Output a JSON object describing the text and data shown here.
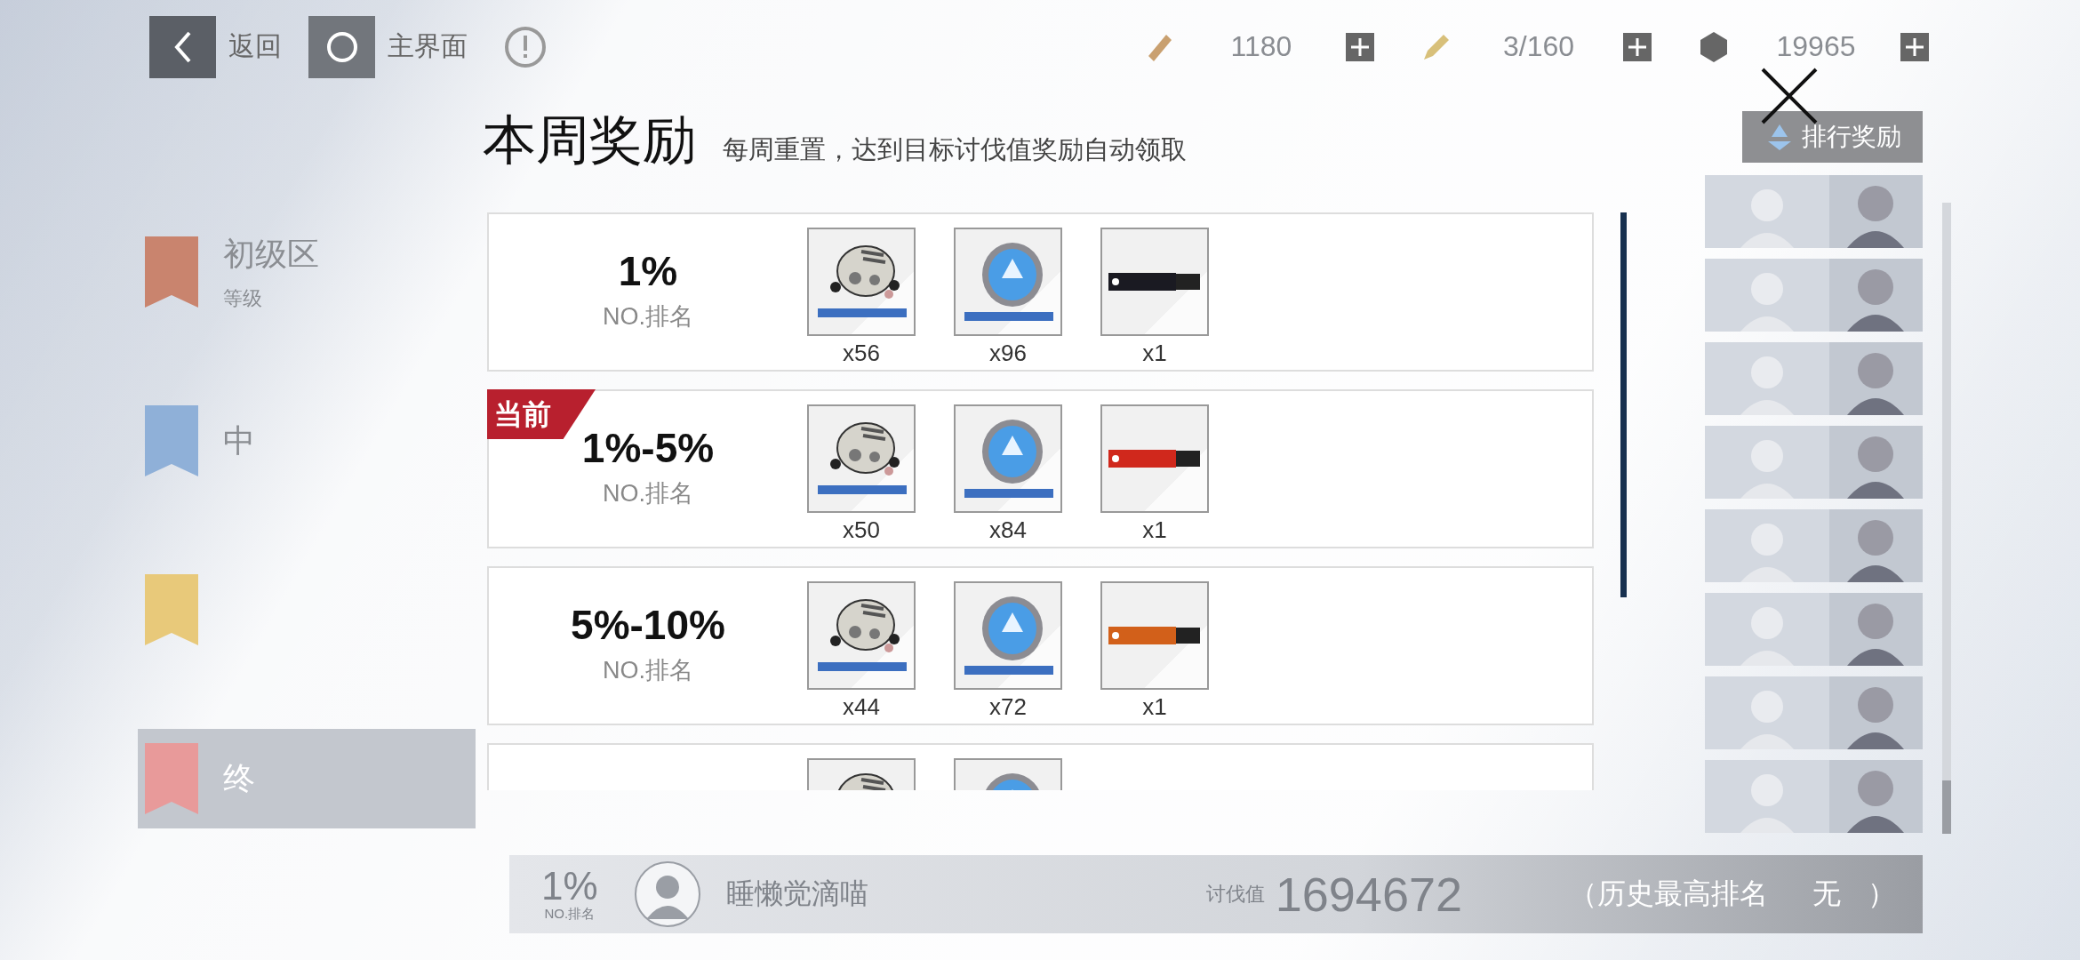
{
  "top_bar": {
    "back_label": "返回",
    "home_label": "主界面",
    "resources": [
      {
        "kind": "ticket",
        "value": "1180"
      },
      {
        "kind": "pen",
        "value": "3/160"
      },
      {
        "kind": "coin",
        "value": "19965"
      }
    ]
  },
  "sidebar": {
    "items": [
      {
        "title": "初级区",
        "subtitle": "等级",
        "color": "#c9846e",
        "selected": false
      },
      {
        "title": "中",
        "color": "#8fb0d8",
        "selected": false
      },
      {
        "color": "#e8c97a",
        "selected": false
      },
      {
        "title": "终",
        "color": "#e89a9a",
        "selected": true
      }
    ]
  },
  "ranking_button": "排行奖励",
  "player_bar": {
    "rank": "1%",
    "rank_label": "NO.排名",
    "name": "睡懒觉滴喵",
    "score_label": "讨伐值",
    "score": "1694672",
    "best_label": "（历史最高排名",
    "best_value": "无",
    "close_paren": "）"
  },
  "modal": {
    "title": "本周奖励",
    "subtitle": "每周重置，达到目标讨伐值奖励自动领取",
    "current_label": "当前",
    "rows": [
      {
        "rank": "1%",
        "rank_label": "NO.排名",
        "current": false,
        "rewards": [
          {
            "kind": "helmet",
            "count": "x56"
          },
          {
            "kind": "disc",
            "count": "x96"
          },
          {
            "kind": "banner",
            "color": "#1a1a22",
            "count": "x1"
          }
        ]
      },
      {
        "rank": "1%-5%",
        "rank_label": "NO.排名",
        "current": true,
        "rewards": [
          {
            "kind": "helmet",
            "count": "x50"
          },
          {
            "kind": "disc",
            "count": "x84"
          },
          {
            "kind": "banner",
            "color": "#d0281c",
            "count": "x1"
          }
        ]
      },
      {
        "rank": "5%-10%",
        "rank_label": "NO.排名",
        "current": false,
        "rewards": [
          {
            "kind": "helmet",
            "count": "x44"
          },
          {
            "kind": "disc",
            "count": "x72"
          },
          {
            "kind": "banner",
            "color": "#d2601a",
            "count": "x1"
          }
        ]
      },
      {
        "current": false,
        "rewards": [
          {
            "kind": "helmet"
          },
          {
            "kind": "disc"
          }
        ]
      }
    ]
  }
}
